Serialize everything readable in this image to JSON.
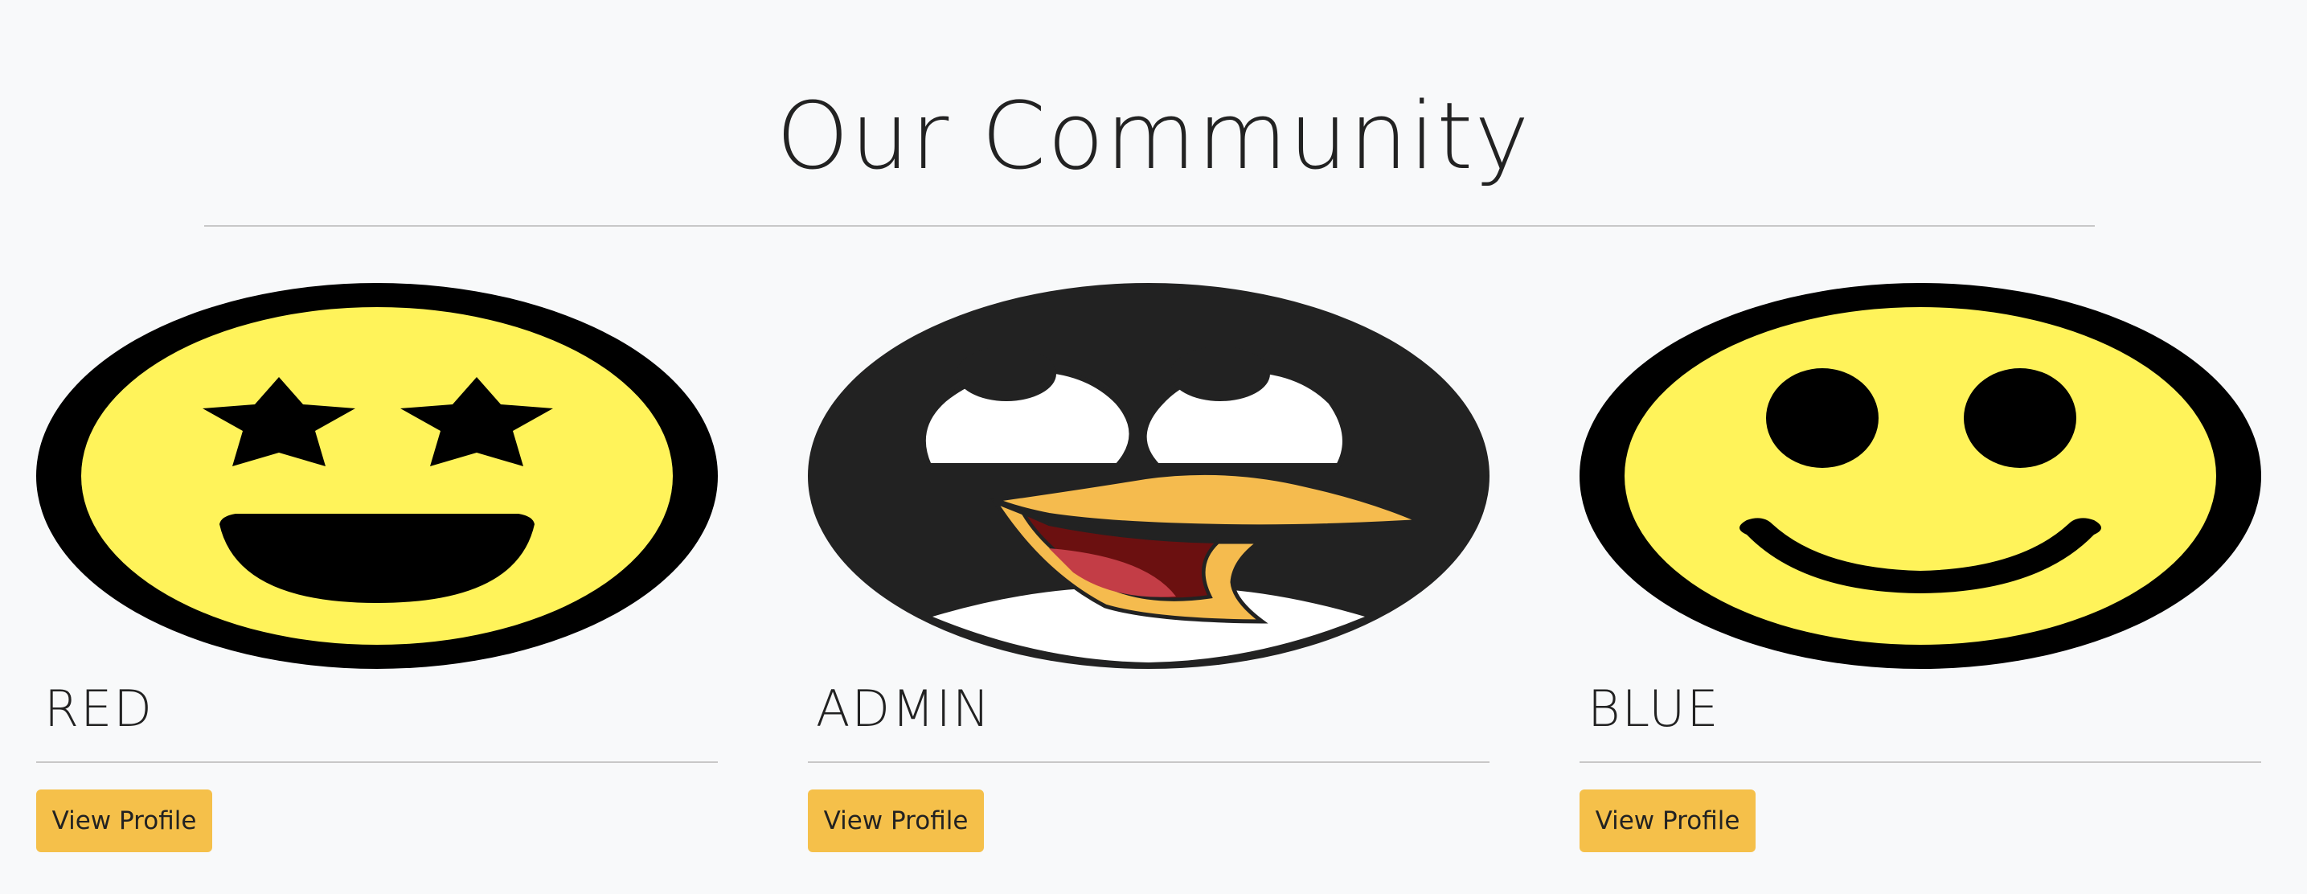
{
  "page": {
    "title": "Our Community"
  },
  "members": [
    {
      "name": "RED",
      "avatar_icon": "star-eyes-smiley-icon",
      "button_label": "View Profile"
    },
    {
      "name": "ADMIN",
      "avatar_icon": "penguin-face-icon",
      "button_label": "View Profile"
    },
    {
      "name": "BLUE",
      "avatar_icon": "smiley-face-icon",
      "button_label": "View Profile"
    }
  ],
  "colors": {
    "background": "#f8f9fa",
    "button": "#f5c04a",
    "smiley_yellow": "#fff35a",
    "penguin_dark": "#222222",
    "beak_orange": "#f5bb4e",
    "mouth_red": "#6b1010"
  }
}
